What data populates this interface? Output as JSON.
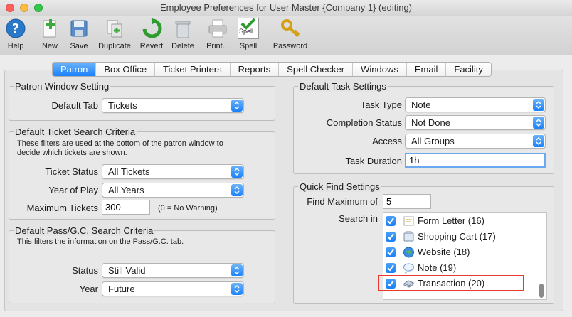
{
  "window": {
    "title": "Employee Preferences for User Master {Company 1} (editing)"
  },
  "toolbar": {
    "help": "Help",
    "new": "New",
    "save": "Save",
    "duplicate": "Duplicate",
    "revert": "Revert",
    "delete": "Delete",
    "print": "Print...",
    "spell": "Spell",
    "spell_icon_text": "Spell",
    "password": "Password"
  },
  "tabs": [
    "Patron",
    "Box Office",
    "Ticket Printers",
    "Reports",
    "Spell Checker",
    "Windows",
    "Email",
    "Facility"
  ],
  "patron_window": {
    "title": "Patron Window Setting",
    "default_tab_label": "Default Tab",
    "default_tab_value": "Tickets"
  },
  "ticket_search": {
    "title": "Default Ticket Search Criteria",
    "desc_line1": "These filters are used at the bottom of the patron window to",
    "desc_line2": "decide which tickets are shown.",
    "status_label": "Ticket Status",
    "status_value": "All Tickets",
    "year_label": "Year of Play",
    "year_value": "All Years",
    "max_label": "Maximum Tickets",
    "max_value": "300",
    "max_note": "(0 = No Warning)"
  },
  "pass_search": {
    "title": "Default Pass/G.C. Search Criteria",
    "desc": "This filters the information on the Pass/G.C. tab.",
    "status_label": "Status",
    "status_value": "Still Valid",
    "year_label": "Year",
    "year_value": "Future"
  },
  "task_settings": {
    "title": "Default Task Settings",
    "type_label": "Task Type",
    "type_value": "Note",
    "completion_label": "Completion Status",
    "completion_value": "Not Done",
    "access_label": "Access",
    "access_value": "All Groups",
    "duration_label": "Task Duration",
    "duration_value": "1h"
  },
  "quick_find": {
    "title": "Quick Find Settings",
    "max_label": "Find Maximum of",
    "max_value": "5",
    "search_in_label": "Search in",
    "items": [
      {
        "label": "Form Letter (16)",
        "icon": "form-letter-icon"
      },
      {
        "label": "Shopping Cart (17)",
        "icon": "shopping-cart-icon"
      },
      {
        "label": "Website (18)",
        "icon": "globe-icon"
      },
      {
        "label": "Note (19)",
        "icon": "speech-bubble-icon"
      },
      {
        "label": "Transaction (20)",
        "icon": "transaction-icon"
      }
    ]
  },
  "colors": {
    "accent": "#1a82fb",
    "highlight": "#e8392e"
  }
}
